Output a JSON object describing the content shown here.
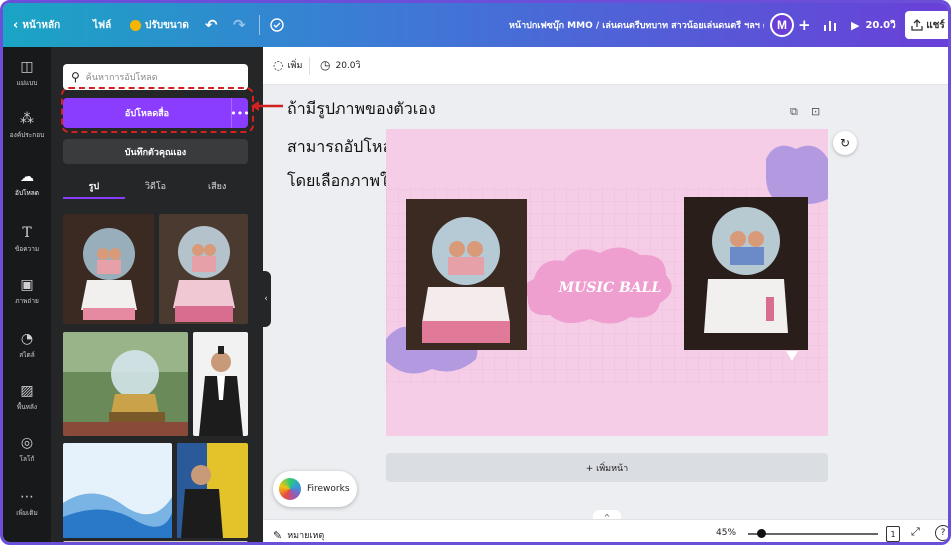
{
  "topbar": {
    "back_label": "หน้าหลัก",
    "file_label": "ไฟล์",
    "resize_label": "ปรับขนาด",
    "doc_title": "หน้าปกเฟซบุ๊ก MMO / เล่นดนตรีบทบาท สาวน้อยเล่นดนตรี ฯลฯ ดั้งเดิม..",
    "avatar_letter": "M",
    "add_symbol": "+",
    "present_label": "20.0วิ",
    "share_label": "แชร์"
  },
  "rail": {
    "items": [
      {
        "label": "แม่แบบ",
        "icon": "template-icon"
      },
      {
        "label": "องค์ประกอบ",
        "icon": "elements-icon"
      },
      {
        "label": "อัปโหลด",
        "icon": "upload-icon"
      },
      {
        "label": "ข้อความ",
        "icon": "text-icon"
      },
      {
        "label": "ภาพถ่าย",
        "icon": "photo-icon"
      },
      {
        "label": "สไตล์",
        "icon": "style-icon"
      },
      {
        "label": "พื้นหลัง",
        "icon": "background-icon"
      },
      {
        "label": "โลโก้",
        "icon": "logo-icon"
      },
      {
        "label": "เพิ่มเติม",
        "icon": "more-icon"
      }
    ]
  },
  "panel": {
    "search_placeholder": "ค้นหาการอัปโหลด",
    "upload_button": "อัปโหลดสื่อ",
    "more_symbol": "•••",
    "record_button": "บันทึกตัวคุณเอง",
    "tabs": [
      "รูป",
      "วิดีโอ",
      "เสียง"
    ]
  },
  "subbar": {
    "animate_label": "เพิ่ม",
    "duration_label": "20.0วิ"
  },
  "annotation": {
    "lines": [
      "ถ้ามีรูปภาพของตัวเอง",
      "สามารถอัปโหลดสื่อเข้ามา",
      "โดยเลือกภาพในเครื่องมาใส่"
    ]
  },
  "slide": {
    "title": "MUSIC BALL",
    "colors": {
      "background": "#f6cde6",
      "cloud_pink": "#ee9fcf",
      "cloud_purple": "#b39ae0"
    }
  },
  "canvas": {
    "add_page_label": "+ เพิ่มหน้า",
    "fireworks_label": "Fireworks"
  },
  "footer": {
    "notes_label": "หมายเหตุ",
    "zoom_label": "45%",
    "zoom_level": 0.45,
    "page_number": "1"
  },
  "colors": {
    "accent": "#8b3dff",
    "frame": "#6b4fd8",
    "annotation_red": "#d32020"
  }
}
